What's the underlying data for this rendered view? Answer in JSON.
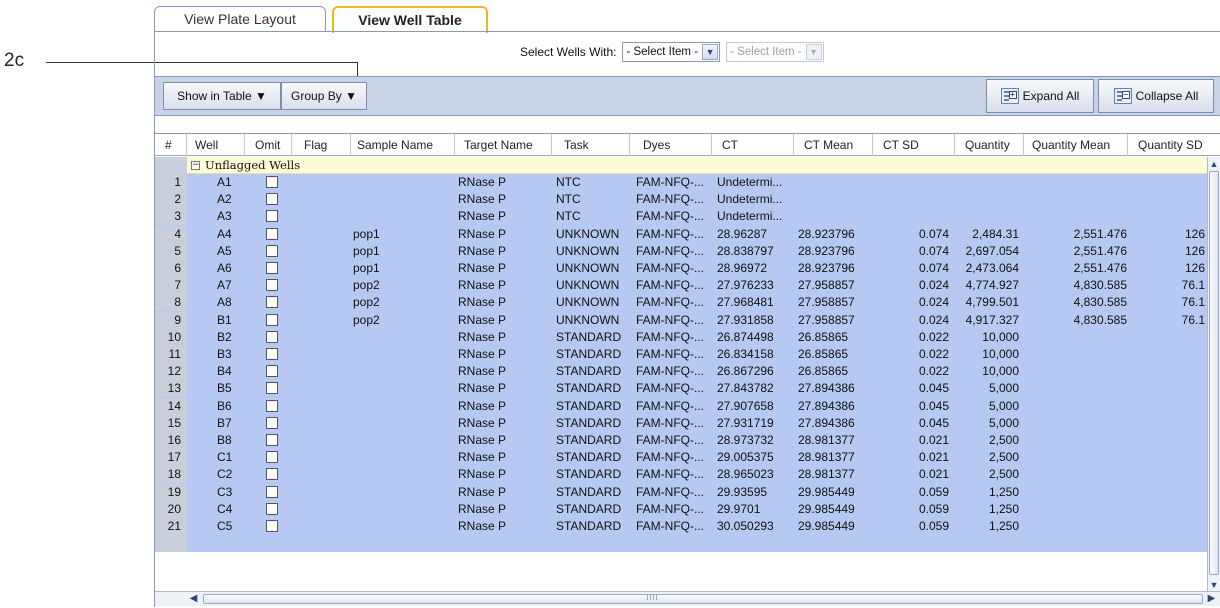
{
  "callout": {
    "label": "2c"
  },
  "tabs": [
    {
      "label": "View Plate Layout",
      "active": false
    },
    {
      "label": "View Well Table",
      "active": true
    }
  ],
  "select_wells": {
    "label": "Select Wells With:",
    "first": {
      "value": "- Select Item -",
      "enabled": true
    },
    "second": {
      "value": "- Select Item -",
      "enabled": false
    }
  },
  "toolbar": {
    "show_in_table": "Show in Table ▼",
    "group_by": "Group By ▼",
    "expand_all": "Expand All",
    "collapse_all": "Collapse All"
  },
  "table": {
    "columns": [
      "#",
      "Well",
      "Omit",
      "Flag",
      "Sample Name",
      "Target Name",
      "Task",
      "Dyes",
      "CT",
      "CT Mean",
      "CT SD",
      "Quantity",
      "Quantity Mean",
      "Quantity SD"
    ],
    "group": {
      "toggle": "−",
      "label": "Unflagged Wells"
    },
    "rows": [
      {
        "n": "1",
        "well": "A1",
        "sample": "",
        "target": "RNase P",
        "task": "NTC",
        "dyes": "FAM-NFQ-...",
        "ct": "Undetermi...",
        "ctmean": "",
        "ctsd": "",
        "qty": "",
        "qtymean": "",
        "qtysd": ""
      },
      {
        "n": "2",
        "well": "A2",
        "sample": "",
        "target": "RNase P",
        "task": "NTC",
        "dyes": "FAM-NFQ-...",
        "ct": "Undetermi...",
        "ctmean": "",
        "ctsd": "",
        "qty": "",
        "qtymean": "",
        "qtysd": ""
      },
      {
        "n": "3",
        "well": "A3",
        "sample": "",
        "target": "RNase P",
        "task": "NTC",
        "dyes": "FAM-NFQ-...",
        "ct": "Undetermi...",
        "ctmean": "",
        "ctsd": "",
        "qty": "",
        "qtymean": "",
        "qtysd": ""
      },
      {
        "n": "4",
        "well": "A4",
        "sample": "pop1",
        "target": "RNase P",
        "task": "UNKNOWN",
        "dyes": "FAM-NFQ-...",
        "ct": "28.96287",
        "ctmean": "28.923796",
        "ctsd": "0.074",
        "qty": "2,484.31",
        "qtymean": "2,551.476",
        "qtysd": "126"
      },
      {
        "n": "5",
        "well": "A5",
        "sample": "pop1",
        "target": "RNase P",
        "task": "UNKNOWN",
        "dyes": "FAM-NFQ-...",
        "ct": "28.838797",
        "ctmean": "28.923796",
        "ctsd": "0.074",
        "qty": "2,697.054",
        "qtymean": "2,551.476",
        "qtysd": "126"
      },
      {
        "n": "6",
        "well": "A6",
        "sample": "pop1",
        "target": "RNase P",
        "task": "UNKNOWN",
        "dyes": "FAM-NFQ-...",
        "ct": "28.96972",
        "ctmean": "28.923796",
        "ctsd": "0.074",
        "qty": "2,473.064",
        "qtymean": "2,551.476",
        "qtysd": "126"
      },
      {
        "n": "7",
        "well": "A7",
        "sample": "pop2",
        "target": "RNase P",
        "task": "UNKNOWN",
        "dyes": "FAM-NFQ-...",
        "ct": "27.976233",
        "ctmean": "27.958857",
        "ctsd": "0.024",
        "qty": "4,774.927",
        "qtymean": "4,830.585",
        "qtysd": "76.1"
      },
      {
        "n": "8",
        "well": "A8",
        "sample": "pop2",
        "target": "RNase P",
        "task": "UNKNOWN",
        "dyes": "FAM-NFQ-...",
        "ct": "27.968481",
        "ctmean": "27.958857",
        "ctsd": "0.024",
        "qty": "4,799.501",
        "qtymean": "4,830.585",
        "qtysd": "76.1"
      },
      {
        "n": "9",
        "well": "B1",
        "sample": "pop2",
        "target": "RNase P",
        "task": "UNKNOWN",
        "dyes": "FAM-NFQ-...",
        "ct": "27.931858",
        "ctmean": "27.958857",
        "ctsd": "0.024",
        "qty": "4,917.327",
        "qtymean": "4,830.585",
        "qtysd": "76.1"
      },
      {
        "n": "10",
        "well": "B2",
        "sample": "",
        "target": "RNase P",
        "task": "STANDARD",
        "dyes": "FAM-NFQ-...",
        "ct": "26.874498",
        "ctmean": "26.85865",
        "ctsd": "0.022",
        "qty": "10,000",
        "qtymean": "",
        "qtysd": ""
      },
      {
        "n": "11",
        "well": "B3",
        "sample": "",
        "target": "RNase P",
        "task": "STANDARD",
        "dyes": "FAM-NFQ-...",
        "ct": "26.834158",
        "ctmean": "26.85865",
        "ctsd": "0.022",
        "qty": "10,000",
        "qtymean": "",
        "qtysd": ""
      },
      {
        "n": "12",
        "well": "B4",
        "sample": "",
        "target": "RNase P",
        "task": "STANDARD",
        "dyes": "FAM-NFQ-...",
        "ct": "26.867296",
        "ctmean": "26.85865",
        "ctsd": "0.022",
        "qty": "10,000",
        "qtymean": "",
        "qtysd": ""
      },
      {
        "n": "13",
        "well": "B5",
        "sample": "",
        "target": "RNase P",
        "task": "STANDARD",
        "dyes": "FAM-NFQ-...",
        "ct": "27.843782",
        "ctmean": "27.894386",
        "ctsd": "0.045",
        "qty": "5,000",
        "qtymean": "",
        "qtysd": ""
      },
      {
        "n": "14",
        "well": "B6",
        "sample": "",
        "target": "RNase P",
        "task": "STANDARD",
        "dyes": "FAM-NFQ-...",
        "ct": "27.907658",
        "ctmean": "27.894386",
        "ctsd": "0.045",
        "qty": "5,000",
        "qtymean": "",
        "qtysd": ""
      },
      {
        "n": "15",
        "well": "B7",
        "sample": "",
        "target": "RNase P",
        "task": "STANDARD",
        "dyes": "FAM-NFQ-...",
        "ct": "27.931719",
        "ctmean": "27.894386",
        "ctsd": "0.045",
        "qty": "5,000",
        "qtymean": "",
        "qtysd": ""
      },
      {
        "n": "16",
        "well": "B8",
        "sample": "",
        "target": "RNase P",
        "task": "STANDARD",
        "dyes": "FAM-NFQ-...",
        "ct": "28.973732",
        "ctmean": "28.981377",
        "ctsd": "0.021",
        "qty": "2,500",
        "qtymean": "",
        "qtysd": ""
      },
      {
        "n": "17",
        "well": "C1",
        "sample": "",
        "target": "RNase P",
        "task": "STANDARD",
        "dyes": "FAM-NFQ-...",
        "ct": "29.005375",
        "ctmean": "28.981377",
        "ctsd": "0.021",
        "qty": "2,500",
        "qtymean": "",
        "qtysd": ""
      },
      {
        "n": "18",
        "well": "C2",
        "sample": "",
        "target": "RNase P",
        "task": "STANDARD",
        "dyes": "FAM-NFQ-...",
        "ct": "28.965023",
        "ctmean": "28.981377",
        "ctsd": "0.021",
        "qty": "2,500",
        "qtymean": "",
        "qtysd": ""
      },
      {
        "n": "19",
        "well": "C3",
        "sample": "",
        "target": "RNase P",
        "task": "STANDARD",
        "dyes": "FAM-NFQ-...",
        "ct": "29.93595",
        "ctmean": "29.985449",
        "ctsd": "0.059",
        "qty": "1,250",
        "qtymean": "",
        "qtysd": ""
      },
      {
        "n": "20",
        "well": "C4",
        "sample": "",
        "target": "RNase P",
        "task": "STANDARD",
        "dyes": "FAM-NFQ-...",
        "ct": "29.9701",
        "ctmean": "29.985449",
        "ctsd": "0.059",
        "qty": "1,250",
        "qtymean": "",
        "qtysd": ""
      },
      {
        "n": "21",
        "well": "C5",
        "sample": "",
        "target": "RNase P",
        "task": "STANDARD",
        "dyes": "FAM-NFQ-...",
        "ct": "30.050293",
        "ctmean": "29.985449",
        "ctsd": "0.059",
        "qty": "1,250",
        "qtymean": "",
        "qtysd": ""
      }
    ]
  },
  "colors": {
    "row_selected": "#b5c9f2",
    "row_number_bg": "#c9cfda",
    "group_row_bg": "#fffbd8",
    "toolbar_bg": "#c9d3e6",
    "active_tab_border": "#f0b429"
  },
  "icons": {
    "expand": "expand-all-icon",
    "collapse": "collapse-all-icon",
    "dropdown": "chevron-down-icon"
  }
}
